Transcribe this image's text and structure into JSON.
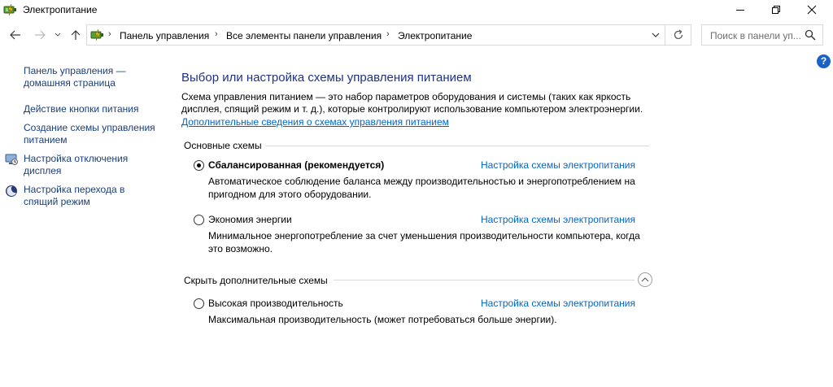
{
  "window": {
    "title": "Электропитание",
    "controls": {
      "minimize": "minimize",
      "maximize": "restore",
      "close": "close"
    }
  },
  "navigation": {
    "breadcrumbs": [
      "Панель управления",
      "Все элементы панели управления",
      "Электропитание"
    ],
    "search_placeholder": "Поиск в панели уп..."
  },
  "sidebar": {
    "home_link": "Панель управления — домашняя страница",
    "items": [
      {
        "label": "Действие кнопки питания",
        "icon": "none"
      },
      {
        "label": "Создание схемы управления питанием",
        "icon": "none"
      },
      {
        "label": "Настройка отключения дисплея",
        "icon": "monitor-icon"
      },
      {
        "label": "Настройка перехода в спящий режим",
        "icon": "moon-icon"
      }
    ]
  },
  "main": {
    "heading": "Выбор или настройка схемы управления питанием",
    "description": "Схема управления питанием — это набор параметров оборудования и системы (таких как яркость дисплея, спящий режим и т. д.), которые контролируют использование компьютером электроэнергии.",
    "more_link": "Дополнительные сведения о схемах управления питанием",
    "basic_group": "Основные схемы",
    "extra_group": "Скрыть дополнительные схемы",
    "plans": [
      {
        "name": "Сбалансированная (рекомендуется)",
        "selected": true,
        "link": "Настройка схемы электропитания",
        "description": "Автоматическое соблюдение баланса между производительностью и энергопотреблением на пригодном для этого оборудовании."
      },
      {
        "name": "Экономия энергии",
        "selected": false,
        "link": "Настройка схемы электропитания",
        "description": "Минимальное энергопотребление за счет уменьшения производительности компьютера, когда это возможно."
      },
      {
        "name": "Высокая производительность",
        "selected": false,
        "link": "Настройка схемы электропитания",
        "description": "Максимальная производительность (может потребоваться больше энергии)."
      }
    ]
  },
  "colors": {
    "heading": "#1e3287",
    "link": "#0066cc",
    "sidebar_link": "#1a3f7a",
    "help": "#1a63c6"
  }
}
